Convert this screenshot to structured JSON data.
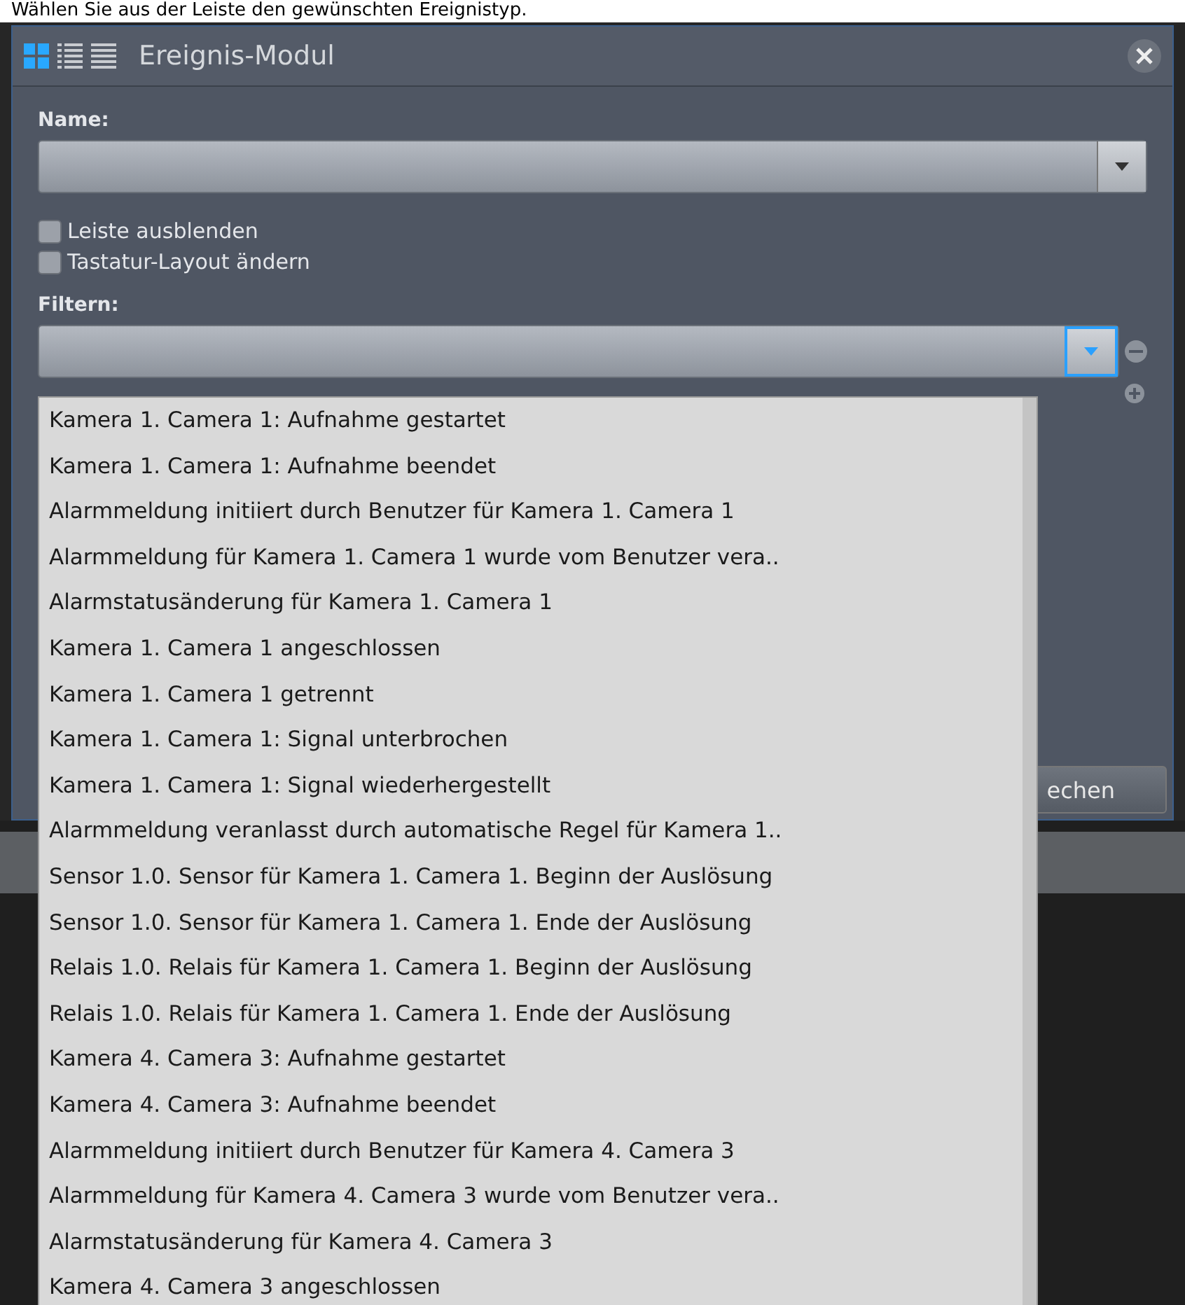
{
  "caption": "Wählen Sie aus der Leiste den gewünschten Ereignistyp.",
  "window": {
    "title": "Ereignis-Modul",
    "views": [
      {
        "kind": "tiles",
        "selected": true
      },
      {
        "kind": "detailed-list",
        "selected": false
      },
      {
        "kind": "list",
        "selected": false
      }
    ]
  },
  "name_label": "Name:",
  "options": [
    {
      "label": "Leiste ausblenden",
      "checked": false
    },
    {
      "label": "Tastatur-Layout ändern",
      "checked": false
    }
  ],
  "filter_label": "Filtern:",
  "buttons": [
    "echen"
  ],
  "dropdown_items": [
    "Kamera 1. Camera 1: Aufnahme gestartet",
    "Kamera 1. Camera 1: Aufnahme beendet",
    "Alarmmeldung initiiert durch Benutzer für Kamera 1. Camera 1",
    "Alarmmeldung für Kamera 1. Camera 1 wurde vom Benutzer vera..",
    "Alarmstatusänderung für Kamera 1. Camera 1",
    "Kamera 1. Camera 1 angeschlossen",
    "Kamera 1. Camera 1 getrennt",
    "Kamera 1. Camera 1: Signal unterbrochen",
    "Kamera 1. Camera 1: Signal wiederhergestellt",
    "Alarmmeldung veranlasst durch automatische Regel für Kamera 1..",
    "Sensor 1.0. Sensor für Kamera 1. Camera 1. Beginn der Auslösung",
    "Sensor 1.0. Sensor für Kamera 1. Camera 1. Ende der Auslösung",
    "Relais 1.0. Relais für Kamera 1. Camera 1. Beginn der Auslösung",
    "Relais 1.0. Relais für Kamera 1. Camera 1. Ende der Auslösung",
    "Kamera 4. Camera 3: Aufnahme gestartet",
    "Kamera 4. Camera 3: Aufnahme beendet",
    "Alarmmeldung initiiert durch Benutzer für Kamera 4. Camera 3",
    "Alarmmeldung für Kamera 4. Camera 3 wurde vom Benutzer vera..",
    "Alarmstatusänderung für Kamera 4. Camera 3",
    "Kamera 4. Camera 3 angeschlossen"
  ]
}
